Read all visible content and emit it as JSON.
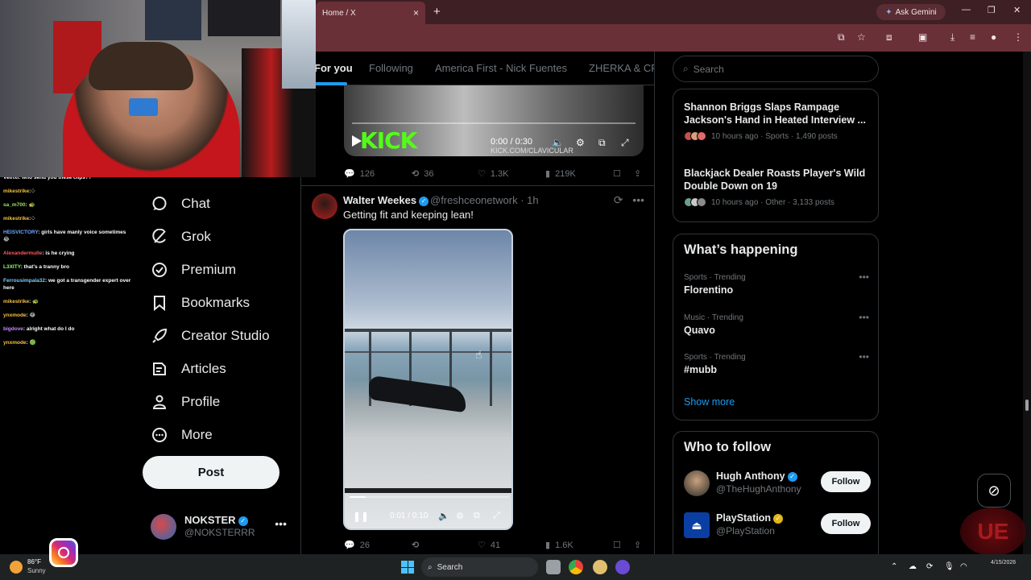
{
  "browser": {
    "tab_title": "Home / X",
    "tab_close": "×",
    "new_tab": "+",
    "ask_gemini": "Ask Gemini"
  },
  "chat": [
    {
      "user": "Veirixi",
      "text": ": who send you these clips??",
      "color": "#ffffff"
    },
    {
      "user": "mikestrike",
      "text": ":⁘",
      "color": "#f6c343"
    },
    {
      "user": "sa_m700",
      "text": ": 🐢",
      "color": "#9ee26a"
    },
    {
      "user": "mikestrike",
      "text": ":⁘",
      "color": "#f6c343"
    },
    {
      "user": "HEISVICTORY",
      "text": ": girls have manly voice sometimes 😂",
      "color": "#6fa8ff"
    },
    {
      "user": "Alexandermulle",
      "text": ": is he crying",
      "color": "#ff5b5b"
    },
    {
      "user": "L3XITY",
      "text": ": that's a tranny bro",
      "color": "#8dff6a"
    },
    {
      "user": "Ferrousimpala32",
      "text": ": we got a transgender expert over here",
      "color": "#7ad0ff"
    },
    {
      "user": "mikestrike",
      "text": ": 🐢",
      "color": "#f6c343"
    },
    {
      "user": "ynxmode",
      "text": ": 😂",
      "color": "#f6c343"
    },
    {
      "user": "bigdove",
      "text": ": alright what do I do",
      "color": "#c88cff"
    },
    {
      "user": "ynxmode",
      "text": ": 🟢",
      "color": "#f6c343"
    }
  ],
  "nav": {
    "items": [
      "Chat",
      "Grok",
      "Premium",
      "Bookmarks",
      "Creator Studio",
      "Articles",
      "Profile",
      "More"
    ],
    "post_label": "Post",
    "account_name": "NOKSTER",
    "account_handle": "@NOKSTERRR"
  },
  "timeline": {
    "tabs": [
      "For you",
      "Following",
      "America First - Nick Fuentes",
      "ZHERKA & CR"
    ],
    "video1": {
      "brand": "KICK",
      "time": "0:00 / 0:30",
      "watermark": "KICK.COM/CLAVICULAR"
    },
    "tweet1_stats": {
      "replies": "126",
      "reposts": "36",
      "likes": "1.3K",
      "views": "219K"
    },
    "tweet2": {
      "name": "Walter Weekes",
      "handle": "@freshceonetwork · 1h",
      "text": "Getting fit and keeping lean!",
      "video_time": "0:01 / 0:10",
      "progress": 0.1,
      "stats": {
        "replies": "26",
        "reposts": "",
        "likes": "41",
        "views": "1.6K"
      }
    }
  },
  "right": {
    "search_placeholder": "Search",
    "news": [
      {
        "title": "Shannon Briggs Slaps Rampage Jackson's Hand in Heated Interview ...",
        "meta": "10 hours ago · Sports · 1,490 posts"
      },
      {
        "title": "Blackjack Dealer Roasts Player's Wild Double Down on 19",
        "meta": "10 hours ago · Other · 3,133 posts"
      }
    ],
    "happening_title": "What’s happening",
    "trends": [
      {
        "context": "Sports · Trending",
        "name": "Florentino"
      },
      {
        "context": "Music · Trending",
        "name": "Quavo"
      },
      {
        "context": "Sports · Trending",
        "name": "#mubb"
      }
    ],
    "show_more": "Show more",
    "wtf_title": "Who to follow",
    "follow": [
      {
        "name": "Hugh Anthony",
        "handle": "@TheHughAnthony",
        "button": "Follow"
      },
      {
        "name": "PlayStation",
        "handle": "@PlayStation",
        "button": "Follow"
      }
    ]
  },
  "taskbar": {
    "temp": "86°F",
    "weather": "Sunny",
    "search": "Search",
    "date": "4/15/2026"
  },
  "overlay": {
    "logo": "UE"
  }
}
